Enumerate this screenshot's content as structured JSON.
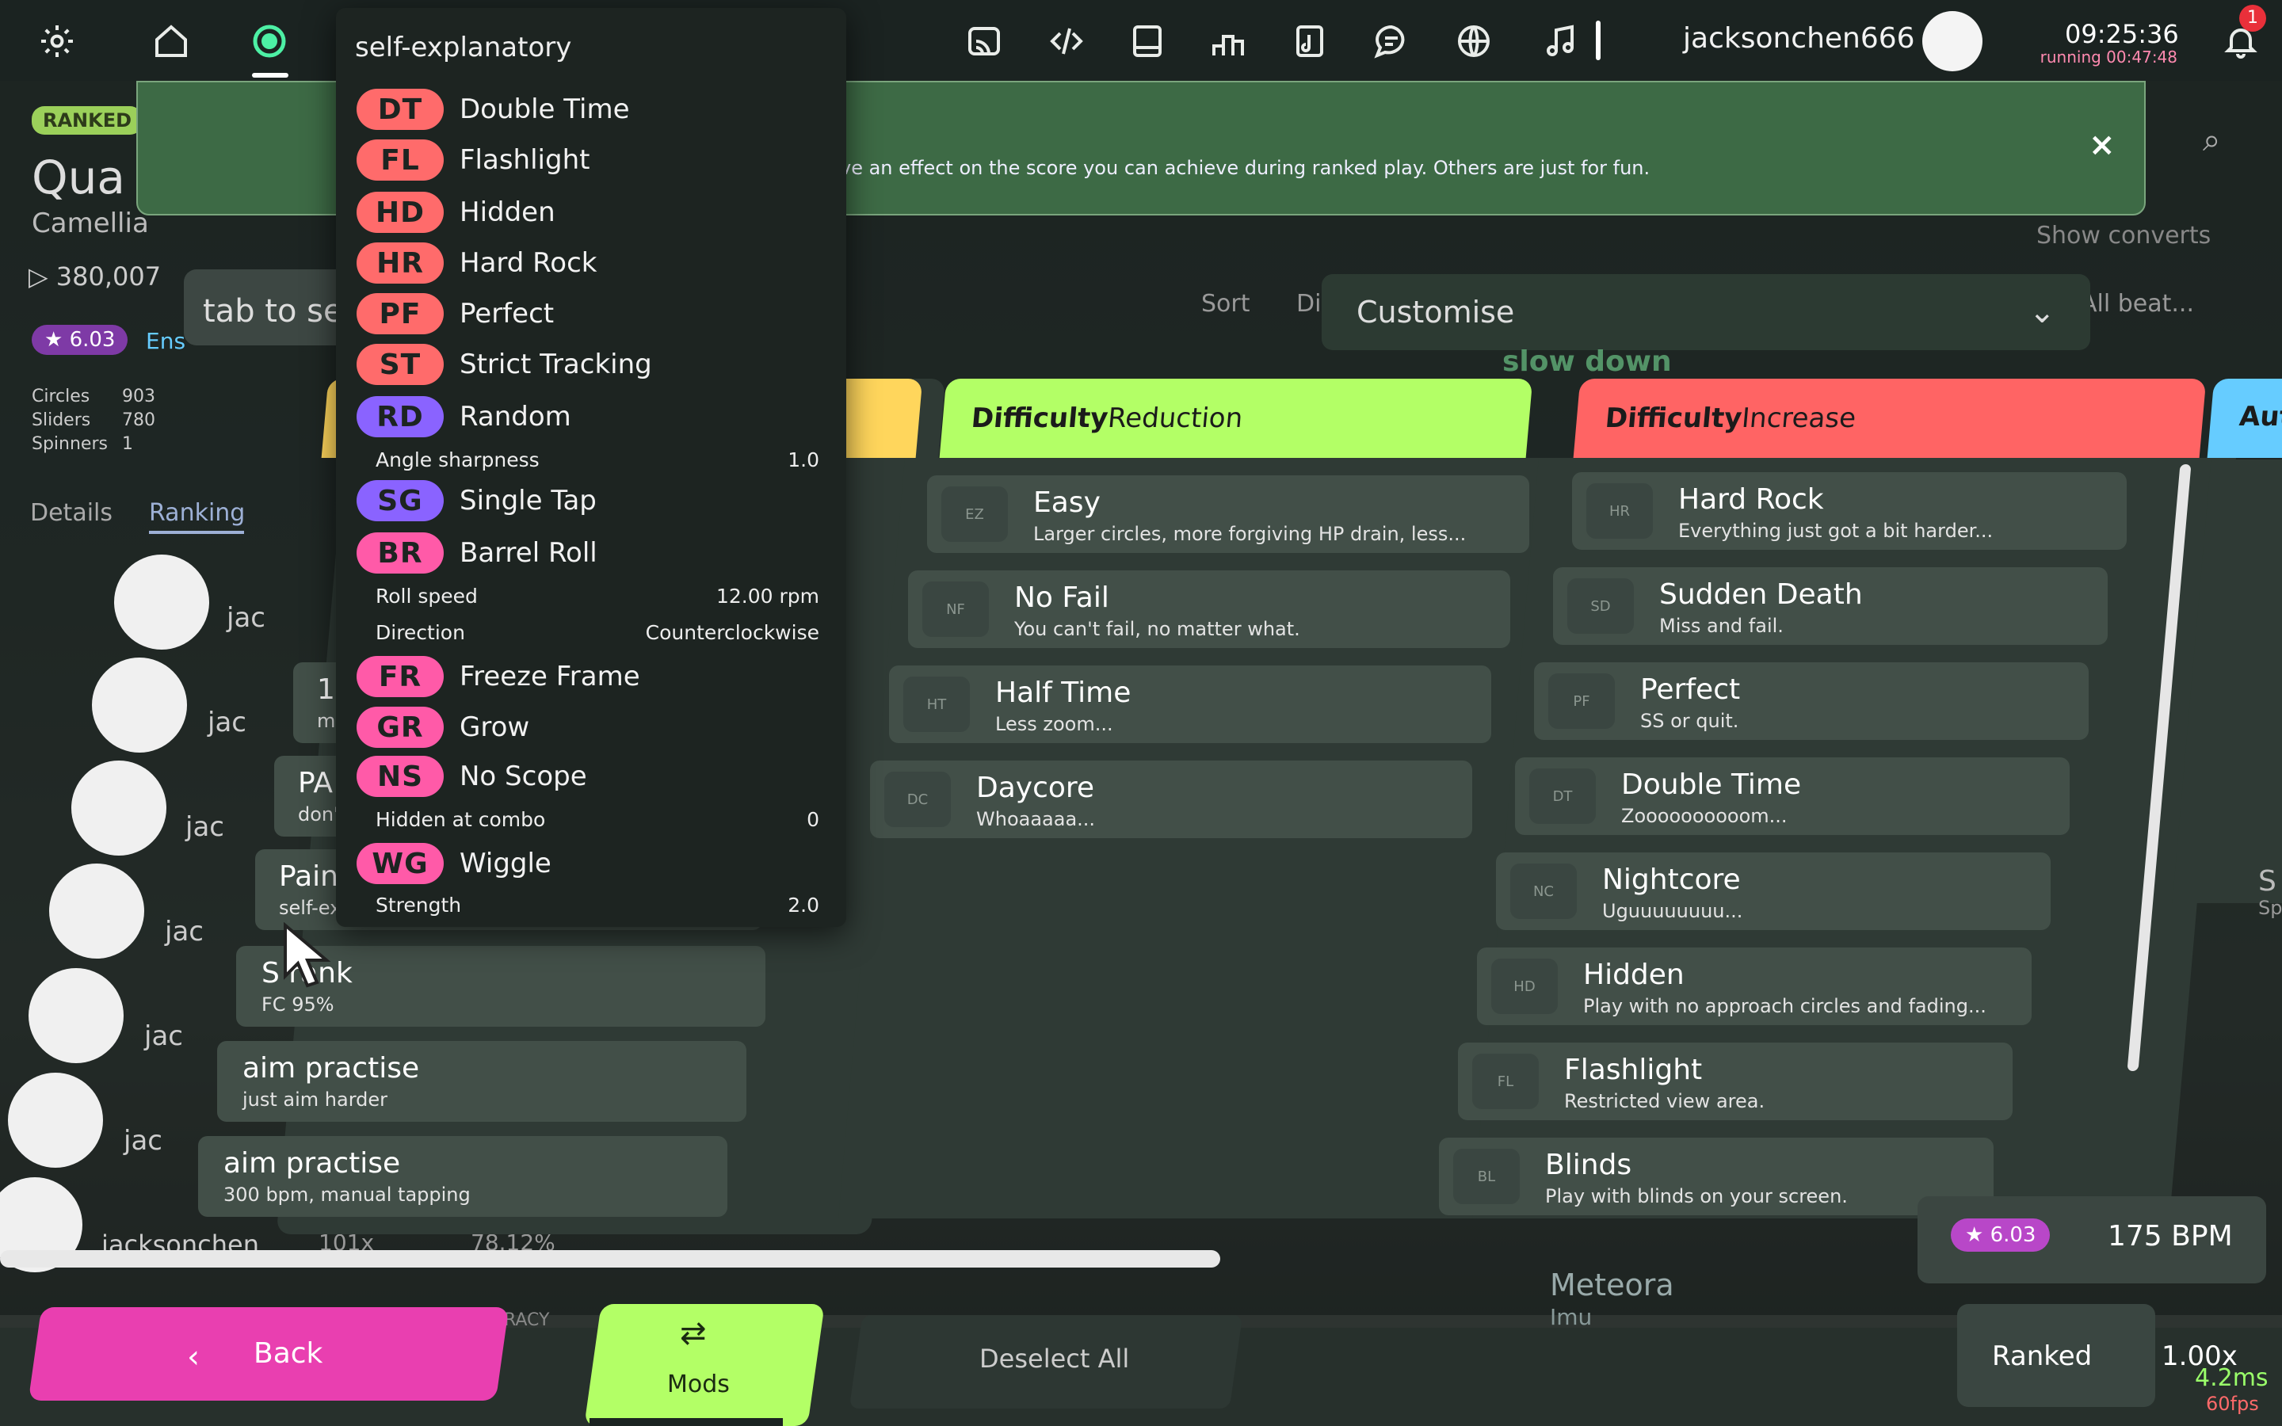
{
  "topbar": {
    "username": "jacksonchen666",
    "time": "09:25:36",
    "running": "running 00:47:48",
    "notification_count": "1"
  },
  "notice": {
    "text": "ve an effect on the score you can achieve during ranked play. Others are just for fun.",
    "close": "×"
  },
  "beatmap": {
    "status": "RANKED",
    "title_partial": "Qua",
    "artist_partial": "Camellia",
    "plays": "380,007",
    "star": "★ 6.03",
    "star_suffix": "Ens",
    "circles_label": "Circles",
    "circles": "903",
    "sliders_label": "Sliders",
    "sliders": "780",
    "spinners_label": "Spinners",
    "spinners": "1",
    "tab_details": "Details",
    "tab_ranking": "Ranking",
    "tab_hint": "tab to se",
    "scores": [
      "jac",
      "jac",
      "jac",
      "jac",
      "jac",
      "jac"
    ],
    "bottom_score_name": "jacksonchen...",
    "bottom_score_mult": "101x",
    "bottom_score_acc": "78.12%",
    "accuracy_hint": "RACY"
  },
  "sort": {
    "label": "Sort",
    "partial": "Di",
    "filter": "All beat...",
    "show_converts": "Show converts"
  },
  "customise": {
    "label": "Customise"
  },
  "hint_slow_down": "slow down",
  "presets": [
    {
      "name": "15",
      "desc": "m"
    },
    {
      "name": "PA",
      "desc": "don'"
    },
    {
      "name": "Pain",
      "desc": "self-ex"
    },
    {
      "name": "S rank",
      "desc": "FC 95%"
    },
    {
      "name": "aim practise",
      "desc": "just aim harder"
    },
    {
      "name": "aim practise",
      "desc": "300 bpm, manual tapping"
    }
  ],
  "columns": {
    "reduction": {
      "title_bold": "Difficulty",
      "title_rest": " Reduction",
      "mods": [
        {
          "acr": "EZ",
          "name": "Easy",
          "desc": "Larger circles, more forgiving HP drain, less..."
        },
        {
          "acr": "NF",
          "name": "No Fail",
          "desc": "You can't fail, no matter what."
        },
        {
          "acr": "HT",
          "name": "Half Time",
          "desc": "Less zoom..."
        },
        {
          "acr": "DC",
          "name": "Daycore",
          "desc": "Whoaaaaa..."
        }
      ]
    },
    "increase": {
      "title_bold": "Difficulty",
      "title_rest": " Increase",
      "mods": [
        {
          "acr": "HR",
          "name": "Hard Rock",
          "desc": "Everything just got a bit harder..."
        },
        {
          "acr": "SD",
          "name": "Sudden Death",
          "desc": "Miss and fail."
        },
        {
          "acr": "PF",
          "name": "Perfect",
          "desc": "SS or quit."
        },
        {
          "acr": "DT",
          "name": "Double Time",
          "desc": "Zoooooooooom..."
        },
        {
          "acr": "NC",
          "name": "Nightcore",
          "desc": "Uguuuuuuuu..."
        },
        {
          "acr": "HD",
          "name": "Hidden",
          "desc": "Play with no approach circles and fading..."
        },
        {
          "acr": "FL",
          "name": "Flashlight",
          "desc": "Restricted view area."
        },
        {
          "acr": "BL",
          "name": "Blinds",
          "desc": "Play with blinds on your screen."
        }
      ]
    },
    "automation": {
      "title_partial": "Aut",
      "partial_desc": "S",
      "partial_desc2": "Sp"
    }
  },
  "dropdown": {
    "title": "self-explanatory",
    "items": [
      {
        "acr": "DT",
        "name": "Double Time",
        "color": "#ff6b6b"
      },
      {
        "acr": "FL",
        "name": "Flashlight",
        "color": "#ff6b6b"
      },
      {
        "acr": "HD",
        "name": "Hidden",
        "color": "#ff6b6b"
      },
      {
        "acr": "HR",
        "name": "Hard Rock",
        "color": "#ff6b6b"
      },
      {
        "acr": "PF",
        "name": "Perfect",
        "color": "#ff6b6b"
      },
      {
        "acr": "ST",
        "name": "Strict Tracking",
        "color": "#ff6b6b"
      },
      {
        "acr": "RD",
        "name": "Random",
        "color": "#8a63ff"
      },
      {
        "acr": "SG",
        "name": "Single Tap",
        "color": "#8a63ff"
      },
      {
        "acr": "BR",
        "name": "Barrel Roll",
        "color": "#ff5aa8"
      },
      {
        "acr": "FR",
        "name": "Freeze Frame",
        "color": "#ff5aa8"
      },
      {
        "acr": "GR",
        "name": "Grow",
        "color": "#ff5aa8"
      },
      {
        "acr": "NS",
        "name": "No Scope",
        "color": "#ff5aa8"
      },
      {
        "acr": "WG",
        "name": "Wiggle",
        "color": "#ff5aa8"
      }
    ],
    "settings": {
      "angle": {
        "label": "Angle sharpness",
        "value": "1.0"
      },
      "roll_speed": {
        "label": "Roll speed",
        "value": "12.00 rpm"
      },
      "direction": {
        "label": "Direction",
        "value": "Counterclockwise"
      },
      "hidden_combo": {
        "label": "Hidden at combo",
        "value": "0"
      },
      "strength": {
        "label": "Strength",
        "value": "2.0"
      }
    }
  },
  "bottom": {
    "back": "Back",
    "mods": "Mods",
    "deselect_all": "Deselect All",
    "ranked": "Ranked",
    "multiplier": "1.00x",
    "frame_time": "4.2ms",
    "fps": "60fps",
    "star_badge": "★ 6.03",
    "bpm": "175 BPM",
    "next_title": "Meteora",
    "next_artist": "Imu"
  },
  "colors": {
    "reduction_header": "#b3ff66",
    "increase_header": "#ff6464",
    "automation_header": "#66ccff",
    "back_button": "#e93fb0",
    "mods_button": "#b3ff66"
  }
}
